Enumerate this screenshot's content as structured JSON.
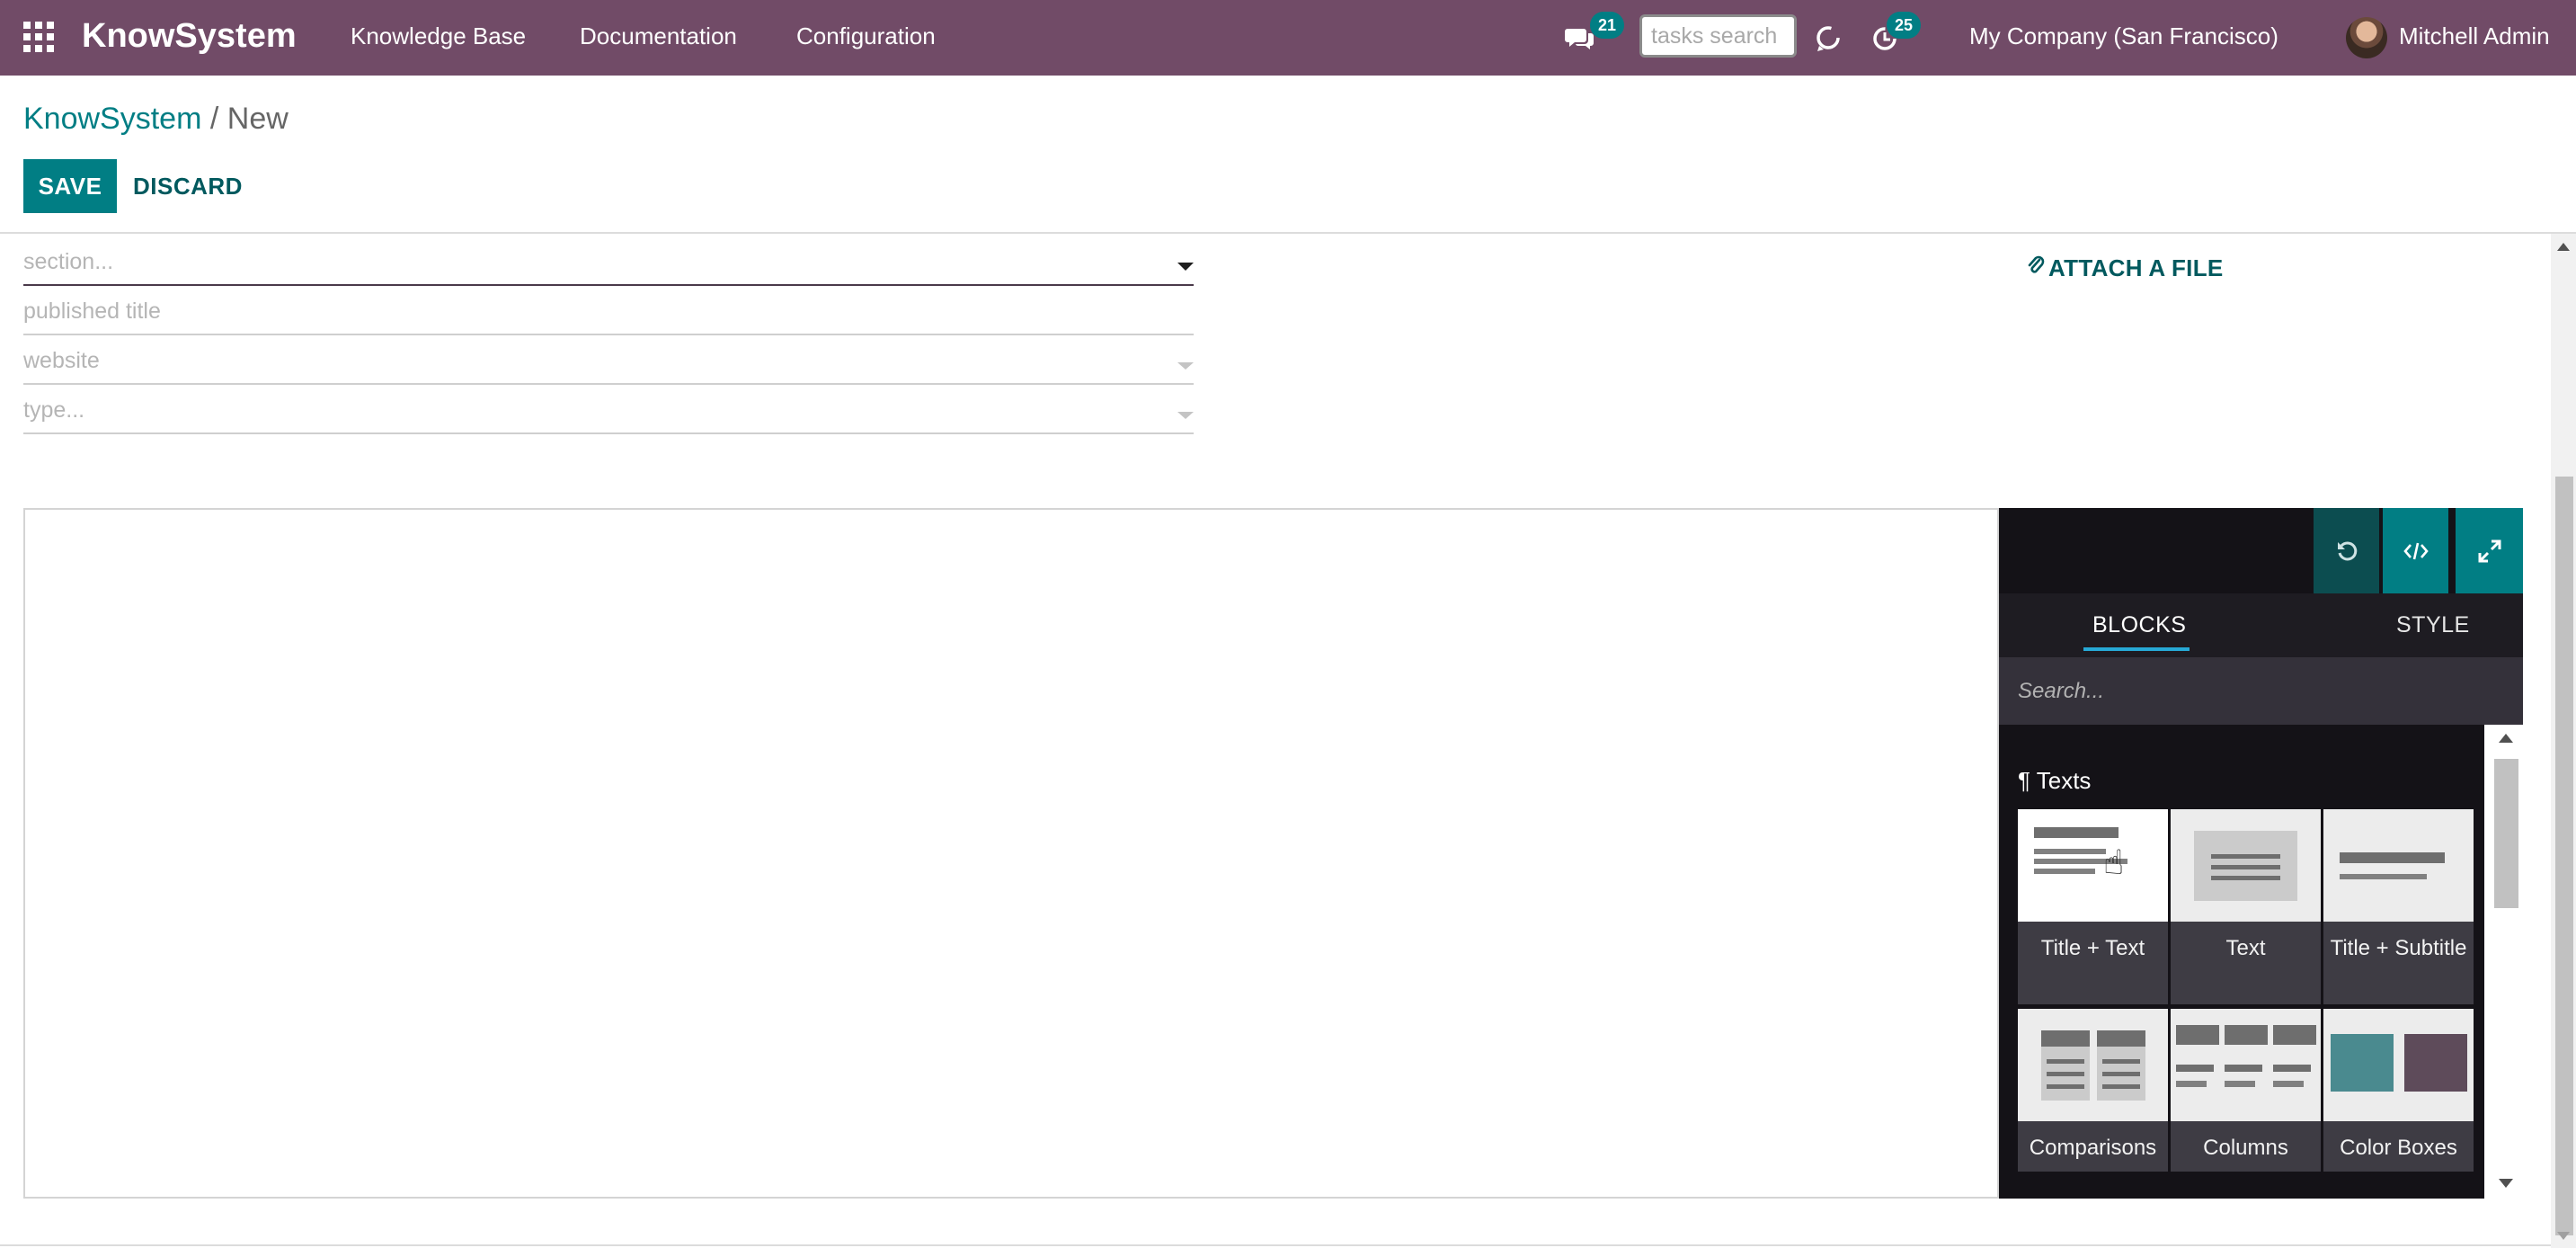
{
  "navbar": {
    "app_name": "KnowSystem",
    "menus": [
      "Knowledge Base",
      "Documentation",
      "Configuration"
    ],
    "messages_count": "21",
    "search_placeholder": "tasks search",
    "activities_count": "25",
    "company": "My Company (San Francisco)",
    "user": "Mitchell Admin",
    "icons": {
      "apps": "apps-grid-icon",
      "chat": "chat-icon",
      "refresh": "refresh-icon",
      "activity": "clock-icon"
    }
  },
  "breadcrumb": {
    "root": "KnowSystem",
    "separator": "/",
    "current": "New"
  },
  "actions": {
    "save": "SAVE",
    "discard": "DISCARD"
  },
  "form": {
    "section_placeholder": "section...",
    "published_title_placeholder": "published title",
    "website_placeholder": "website",
    "type_placeholder": "type...",
    "attach_label": "ATTACH A FILE"
  },
  "snippets_panel": {
    "tabs": [
      "BLOCKS",
      "STYLE"
    ],
    "active_tab": "BLOCKS",
    "search_placeholder": "Search...",
    "section_icon": "¶",
    "section_title": "Texts",
    "blocks": [
      "Title + Text",
      "Text",
      "Title + Subtitle",
      "Comparisons",
      "Columns",
      "Color Boxes"
    ]
  },
  "colors": {
    "navbar": "#714b67",
    "primary": "#017e84",
    "panel_bg": "#141217",
    "tab_underline": "#27a9d6",
    "color_box_teal": "#4a8a8f",
    "color_box_plum": "#5e4b5a"
  }
}
